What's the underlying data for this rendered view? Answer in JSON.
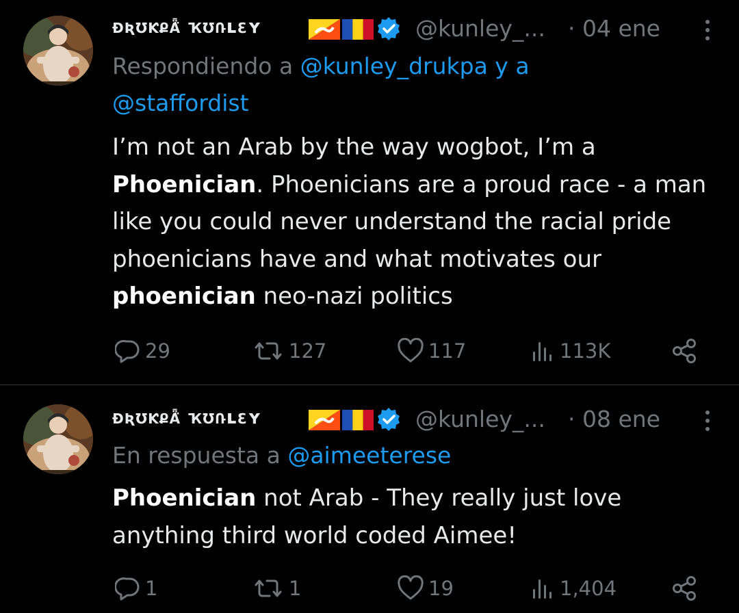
{
  "colors": {
    "background": "#000000",
    "text": "#e7e9ea",
    "muted": "#71767b",
    "accent": "#1d9bf0",
    "divider": "#2f3336"
  },
  "tweets": [
    {
      "display_name": "ɖʀʊƙքǟ̈ ҡʊռʟɛʏ",
      "flags": [
        "bhutan-flag-icon",
        "romania-flag-icon"
      ],
      "verified_icon": "verified-badge-icon",
      "handle": "@kunley_...",
      "date": "· 04 ene",
      "reply_prefix": "Respondiendo a ",
      "reply_mention_1": "@kunley_drukpa",
      "reply_join": " y a ",
      "reply_mention_2": "@staffordist",
      "text_1": "I’m not an Arab by the way wogbot, I’m a ",
      "text_bold_1": "Phoenician",
      "text_2": ". Phoenicians are a proud race - a man like you could never understand the racial pride phoenicians have and what motivates our ",
      "text_bold_2": "phoenician",
      "text_3": " neo-nazi politics",
      "replies": "29",
      "retweets": "127",
      "likes": "117",
      "views": "113K"
    },
    {
      "display_name": "ɖʀʊƙքǟ̈ ҡʊռʟɛʏ",
      "flags": [
        "bhutan-flag-icon",
        "romania-flag-icon"
      ],
      "verified_icon": "verified-badge-icon",
      "handle": "@kunley_...",
      "date": "· 08 ene",
      "reply_prefix": "En respuesta a ",
      "reply_mention_1": "@aimeeterese",
      "text_bold_1": "Phoenician",
      "text_1": " not Arab - They really just love anything third world coded Aimee!",
      "replies": "1",
      "retweets": "1",
      "likes": "19",
      "views": "1,404"
    }
  ]
}
